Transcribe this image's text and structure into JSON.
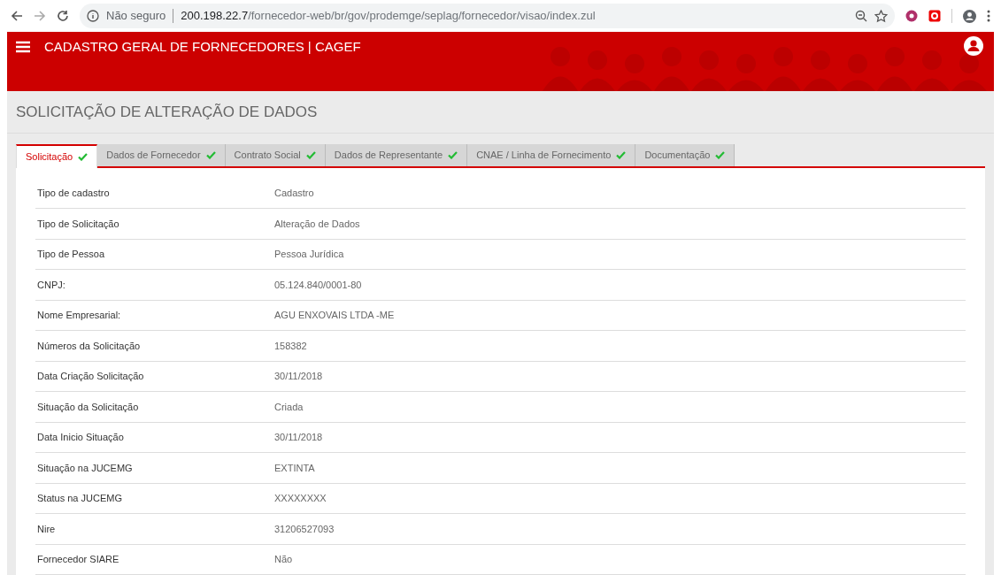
{
  "browser": {
    "security": "Não seguro",
    "url_host": "200.198.22.7",
    "url_path": "/fornecedor-web/br/gov/prodemge/seplag/fornecedor/visao/index.zul"
  },
  "header": {
    "title": "CADASTRO GERAL DE FORNECEDORES | CAGEF"
  },
  "page_title": "SOLICITAÇÃO DE ALTERAÇÃO DE DADOS",
  "tabs": [
    {
      "label": "Solicitação",
      "selected": true
    },
    {
      "label": "Dados de Fornecedor",
      "selected": false
    },
    {
      "label": "Contrato Social",
      "selected": false
    },
    {
      "label": "Dados de Representante",
      "selected": false
    },
    {
      "label": "CNAE / Linha de Fornecimento",
      "selected": false
    },
    {
      "label": "Documentação",
      "selected": false
    }
  ],
  "fields": [
    {
      "label": "Tipo de cadastro",
      "value": "Cadastro"
    },
    {
      "label": "Tipo de Solicitação",
      "value": "Alteração de Dados"
    },
    {
      "label": "Tipo de Pessoa",
      "value": "Pessoa Jurídica"
    },
    {
      "label": "CNPJ:",
      "value": "05.124.840/0001-80"
    },
    {
      "label": "Nome Empresarial:",
      "value": "AGU ENXOVAIS LTDA -ME"
    },
    {
      "label": "Números da Solicitação",
      "value": "158382"
    },
    {
      "label": "Data Criação Solicitação",
      "value": "30/11/2018"
    },
    {
      "label": "Situação da Solicitação",
      "value": "Criada"
    },
    {
      "label": "Data Inicio Situação",
      "value": "30/11/2018"
    },
    {
      "label": "Situação na JUCEMG",
      "value": "EXTINTA"
    },
    {
      "label": "Status na JUCEMG",
      "value": "XXXXXXXX"
    },
    {
      "label": "Nire",
      "value": "31206527093"
    },
    {
      "label": "Fornecedor SIARE",
      "value": "Não"
    }
  ]
}
